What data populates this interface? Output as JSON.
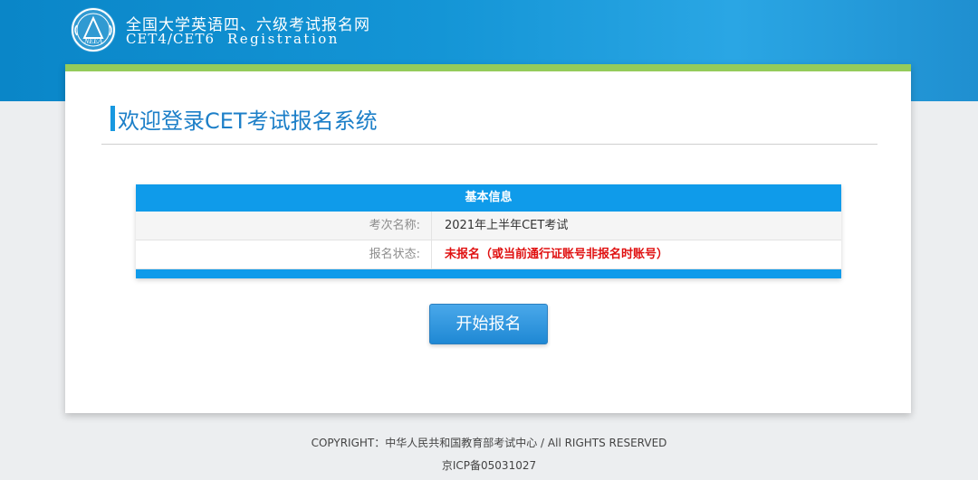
{
  "header": {
    "logo_text": "NEEA",
    "title_cn": "全国大学英语四、六级考试报名网",
    "title_en_1": "CET4/CET6",
    "title_en_2": "Registration"
  },
  "main": {
    "title": "欢迎登录CET考试报名系统",
    "info": {
      "heading": "基本信息",
      "rows": [
        {
          "label": "考次名称:",
          "value": "2021年上半年CET考试"
        },
        {
          "label": "报名状态:",
          "value": "未报名（或当前通行证账号非报名时账号）"
        }
      ]
    },
    "start_button": "开始报名"
  },
  "footer": {
    "copyright": "COPYRIGHT：中华人民共和国教育部考试中心 / All RIGHTS RESERVED",
    "icp": "京ICP备05031027"
  },
  "colors": {
    "header_blue": "#1495d6",
    "accent_green": "#94cb5a",
    "title_blue": "#1c7fc8",
    "table_blue": "#0f9bea",
    "warning_red": "#e01010"
  },
  "icons": {
    "logo": "neea-logo-icon"
  }
}
